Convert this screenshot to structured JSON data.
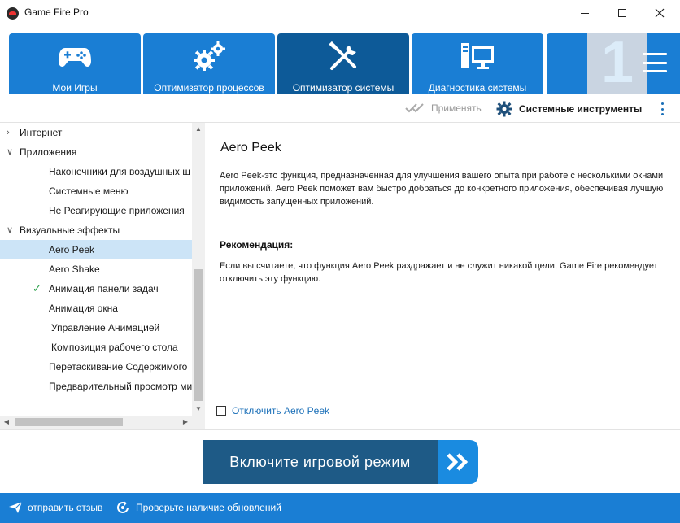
{
  "window": {
    "title": "Game Fire Pro"
  },
  "tabs": [
    {
      "label": "Мои Игры",
      "icon": "gamepad-icon",
      "active": false
    },
    {
      "label": "Оптимизатор процессов",
      "icon": "gears-icon",
      "active": false
    },
    {
      "label": "Оптимизатор системы",
      "icon": "tools-icon",
      "active": true
    },
    {
      "label": "Диагностика системы",
      "icon": "computer-icon",
      "active": false
    }
  ],
  "brand": {
    "badge_text": "1"
  },
  "toolbar": {
    "apply_label": "Применять",
    "tools_label": "Системные инструменты"
  },
  "tree": {
    "items": [
      {
        "label": "Интернет",
        "level": 0,
        "expander": "collapsed"
      },
      {
        "label": "Приложения",
        "level": 0,
        "expander": "expanded"
      },
      {
        "label": "Наконечники для воздушных ш",
        "level": 1
      },
      {
        "label": "Системные меню",
        "level": 1
      },
      {
        "label": "Не Реагирующие приложения",
        "level": 1
      },
      {
        "label": "Визуальные эффекты",
        "level": 0,
        "expander": "expanded"
      },
      {
        "label": "Aero Peek",
        "level": 1,
        "selected": true
      },
      {
        "label": "Aero Shake",
        "level": 1
      },
      {
        "label": "Анимация панели задач",
        "level": 1,
        "checked": true
      },
      {
        "label": "Анимация окна",
        "level": 1
      },
      {
        "label": "Управление Анимацией",
        "level": 1
      },
      {
        "label": "Композиция рабочего стола",
        "level": 1
      },
      {
        "label": "Перетаскивание Содержимого",
        "level": 1
      },
      {
        "label": "Предварительный просмотр ми",
        "level": 1
      }
    ]
  },
  "content": {
    "title": "Aero Peek",
    "description": "Aero Peek-это функция, предназначенная для улучшения вашего опыта при работе с несколькими окнами приложений. Aero Peek поможет вам быстро добраться до конкретного приложения, обеспечивая лучшую видимость запущенных приложений.",
    "recommendation_heading": "Рекомендация:",
    "recommendation": "Если вы считаете, что функция Aero Peek раздражает и не служит никакой цели, Game Fire рекомендует отключить эту функцию.",
    "disable_label": "Отключить Aero Peek",
    "disable_checked": false
  },
  "game_mode": {
    "label": "Включите игровой режим"
  },
  "status": {
    "feedback_label": "отправить отзыв",
    "updates_label": "Проверьте наличие обновлений"
  },
  "colors": {
    "tab_blue": "#1a7ed4",
    "tab_active": "#0d5a98",
    "selection": "#cce4f7",
    "link": "#1a6fb8",
    "game_button": "#1e5a86",
    "game_arrow": "#1a8be0"
  }
}
